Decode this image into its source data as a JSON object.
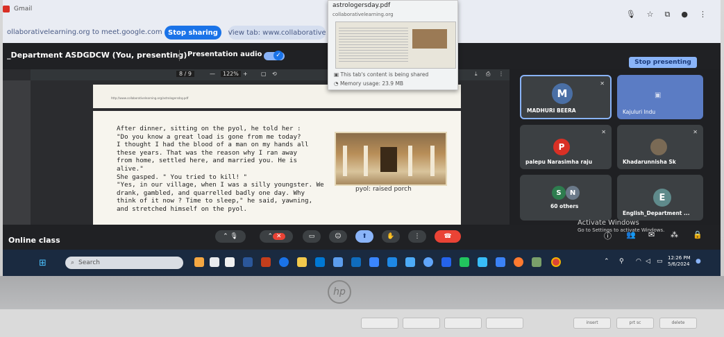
{
  "browser": {
    "tab_title": "Gmail",
    "share_text": "ollaborativelearning.org to meet.google.com",
    "stop_sharing": "Stop sharing",
    "view_tab": "View tab: www.collaborative"
  },
  "meet": {
    "title": "_Department ASDGDCW (You, presenting)",
    "presentation_audio": "Presentation audio",
    "stop_presenting": "Stop presenting",
    "meeting_name": "Online class",
    "activate_title": "Activate Windows",
    "activate_sub": "Go to Settings to activate Windows."
  },
  "popup": {
    "file": "astrologersday.pdf",
    "url": "collaborativelearning.org",
    "shared_line": "This tab's content is being shared",
    "memory_line": "Memory usage: 23.9 MB"
  },
  "pdf": {
    "page": "8",
    "total": "/ 9",
    "zoom": "122%",
    "page_url": "http://www.collaborativelearning.org/astrologersday.pdf",
    "story": [
      "After dinner, sitting on the pyol, he told her :",
      "\"Do you know a great load is gone from me today?",
      "I thought I had the blood of a man on my hands all",
      "these years. That was the reason why I ran away",
      "from home, settled here, and married you. He is",
      "alive.\"",
      "She gasped. \" You tried to kill! \"",
      "\"Yes, in our village, when I was a silly youngster. We",
      "drank, gambled, and quarrelled badly one day. Why",
      "think of it now ? Time to sleep,\" he said, yawning,",
      "and stretched himself on the pyol."
    ],
    "caption": "pyol: raised porch"
  },
  "participants": [
    {
      "name": "MADHURI BEERA",
      "initial": "M",
      "color": "#4a6fa5"
    },
    {
      "name": "Kajuluri Indu",
      "initial": "",
      "color": "#5b7cc4"
    },
    {
      "name": "palepu Narasimha raju",
      "initial": "P",
      "color": "#d93025"
    },
    {
      "name": "Khadarunnisha Sk",
      "initial": "",
      "color": "#7a6a55"
    },
    {
      "name": "60 others",
      "initial": "",
      "color": "#3c4043"
    },
    {
      "name": "English_Department ...",
      "initial": "E",
      "color": "#5f8a8b"
    }
  ],
  "others_avatars": [
    "S",
    "N"
  ],
  "taskbar": {
    "search": "Search",
    "time": "12:26 PM",
    "date": "5/6/2024"
  },
  "keyboard_keys": [
    "",
    "",
    "",
    "",
    "insert",
    "prt sc",
    "delete"
  ]
}
